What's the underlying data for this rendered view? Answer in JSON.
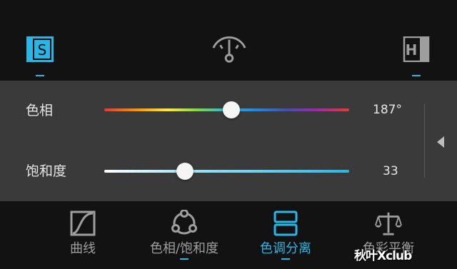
{
  "colors": {
    "accent": "#29b6e6",
    "icon_inactive": "#9e9e9e",
    "panel_bg": "#3a3a3a",
    "bar_bg": "#121212"
  },
  "top_toolbar": {
    "items": [
      {
        "name": "s-icon",
        "glyph": "S",
        "selected": true
      },
      {
        "name": "gauge-icon",
        "selected": false
      },
      {
        "name": "h-icon",
        "glyph": "H",
        "selected": false
      }
    ]
  },
  "sliders": [
    {
      "label": "色相",
      "value_text": "187°",
      "value": 187,
      "min": 0,
      "max": 360,
      "track": "hue-gradient"
    },
    {
      "label": "饱和度",
      "value_text": "33",
      "value": 33,
      "min": 0,
      "max": 100,
      "track": "saturation-gradient"
    }
  ],
  "bottom_tabs": [
    {
      "label": "曲线",
      "icon": "curve-icon",
      "selected": false,
      "marked": false
    },
    {
      "label": "色相/饱和度",
      "icon": "hue-circle-icon",
      "selected": false,
      "marked": true
    },
    {
      "label": "色调分离",
      "icon": "split-tone-icon",
      "selected": true,
      "marked": true
    },
    {
      "label": "色彩平衡",
      "icon": "balance-scale-icon",
      "selected": false,
      "marked": false
    }
  ],
  "watermark": "秋叶Xclub"
}
